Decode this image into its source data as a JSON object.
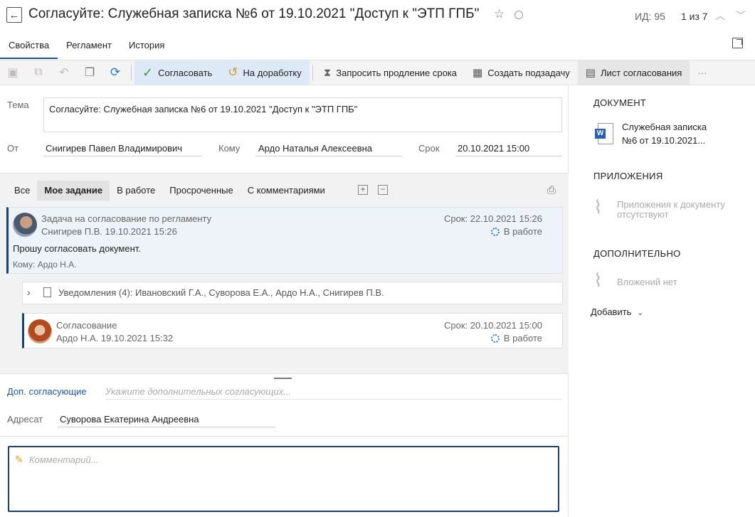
{
  "header": {
    "title": "Согласуйте: Служебная записка №6 от 19.10.2021 \"Доступ к \"ЭТП ГПБ\"",
    "id_label": "ИД: 95",
    "pager": "1 из 7"
  },
  "tabs": [
    {
      "label": "Свойства",
      "active": true
    },
    {
      "label": "Регламент",
      "active": false
    },
    {
      "label": "История",
      "active": false
    }
  ],
  "toolbar": {
    "approve": "Согласовать",
    "rework": "На доработку",
    "extend": "Запросить продление срока",
    "subtask": "Создать подзадачу",
    "sheet": "Лист согласования",
    "more": "···"
  },
  "form": {
    "subject_label": "Тема",
    "subject": "Согласуйте: Служебная записка №6 от 19.10.2021 \"Доступ к \"ЭТП ГПБ\"",
    "from_label": "От",
    "from": "Снигирев Павел Владимирович",
    "to_label": "Кому",
    "to": "Ардо Наталья Алексеевна",
    "due_label": "Срок",
    "due": "20.10.2021 15:00"
  },
  "filters": [
    "Все",
    "Мое задание",
    "В работе",
    "Просроченные",
    "С комментариями"
  ],
  "tasks": {
    "main": {
      "title": "Задача на согласование по регламенту",
      "author": "Снигирев П.В.  19.10.2021 15:26",
      "due": "Срок: 22.10.2021 15:26",
      "status": "В работе",
      "message": "Прошу согласовать документ.",
      "to": "Кому: Ардо Н.А."
    },
    "notifications": "Уведомления (4): Ивановский Г.А., Суворова Е.А., Ардо Н.А., Снигирев П.В.",
    "approval": {
      "title": "Согласование",
      "author": "Ардо Н.А.  19.10.2021 15:32",
      "due": "Срок: 20.10.2021 15:00",
      "status": "В работе"
    }
  },
  "extra": {
    "co_approvers_label": "Доп. согласующие",
    "co_approvers_placeholder": "Укажите дополнительных согласующих...",
    "addressee_label": "Адресат",
    "addressee": "Суворова Екатерина Андреевна",
    "comment_placeholder": "Комментарий..."
  },
  "sidebar": {
    "document_title": "ДОКУМЕНТ",
    "document_name_1": "Служебная записка",
    "document_name_2": "№6 от 19.10.2021...",
    "attachments_title": "ПРИЛОЖЕНИЯ",
    "attachments_empty_1": "Приложения к документу",
    "attachments_empty_2": "отсутствуют",
    "additional_title": "ДОПОЛНИТЕЛЬНО",
    "additional_empty": "Вложений нет",
    "add_label": "Добавить"
  }
}
